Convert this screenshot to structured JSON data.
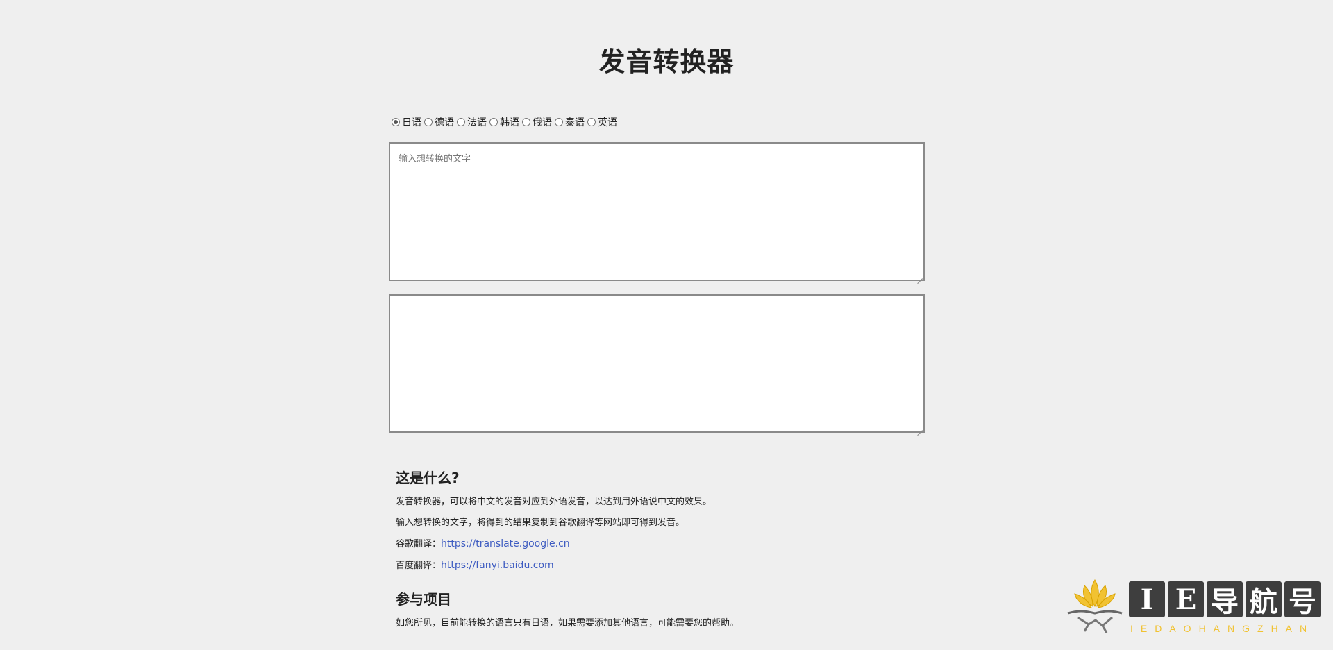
{
  "page": {
    "title": "发音转换器"
  },
  "languages": [
    {
      "label": "日语",
      "checked": true
    },
    {
      "label": "德语",
      "checked": false
    },
    {
      "label": "法语",
      "checked": false
    },
    {
      "label": "韩语",
      "checked": false
    },
    {
      "label": "俄语",
      "checked": false
    },
    {
      "label": "泰语",
      "checked": false
    },
    {
      "label": "英语",
      "checked": false
    }
  ],
  "input": {
    "placeholder": "输入想转换的文字",
    "value": ""
  },
  "output": {
    "value": ""
  },
  "about": {
    "heading": "这是什么?",
    "para1": "发音转换器，可以将中文的发音对应到外语发音，以达到用外语说中文的效果。",
    "para2": "输入想转换的文字，将得到的结果复制到谷歌翻译等网站即可得到发音。",
    "google_label": "谷歌翻译：",
    "google_link": "https://translate.google.cn",
    "baidu_label": "百度翻译：",
    "baidu_link": "https://fanyi.baidu.com"
  },
  "participate": {
    "heading": "参与项目",
    "para1": "如您所见，目前能转换的语言只有日语，如果需要添加其他语言，可能需要您的帮助。"
  },
  "watermark": {
    "chars": [
      "I",
      "E",
      "导",
      "航",
      "号"
    ],
    "subtitle": "IEDAOHANGZHAN",
    "colors": {
      "mark": "#3e3e3e",
      "accent": "#f1c232"
    }
  }
}
